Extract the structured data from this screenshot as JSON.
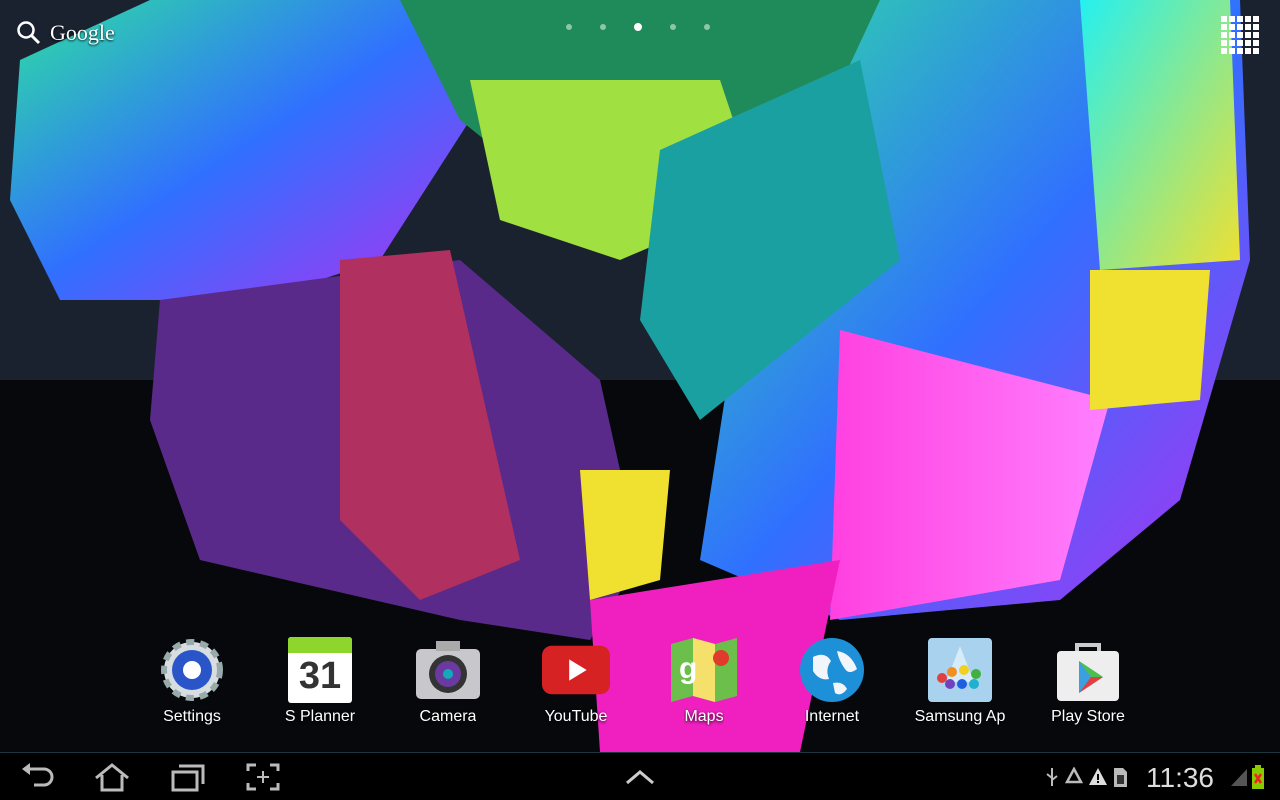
{
  "search": {
    "label": "Google",
    "icon": "search-icon"
  },
  "pages": {
    "count": 5,
    "current": 3
  },
  "dock": [
    {
      "label": "Settings",
      "icon": "gear-icon"
    },
    {
      "label": "S Planner",
      "icon": "calendar-icon",
      "date": "31"
    },
    {
      "label": "Camera",
      "icon": "camera-icon"
    },
    {
      "label": "YouTube",
      "icon": "youtube-icon"
    },
    {
      "label": "Maps",
      "icon": "maps-icon"
    },
    {
      "label": "Internet",
      "icon": "globe-icon"
    },
    {
      "label": "Samsung Ap",
      "icon": "samsung-apps-icon"
    },
    {
      "label": "Play Store",
      "icon": "play-store-icon"
    }
  ],
  "status": {
    "time": "11:36",
    "icons": [
      "usb-icon",
      "recycle-icon",
      "warning-icon",
      "sd-card-icon",
      "signal-icon",
      "battery-icon"
    ]
  },
  "colors": {
    "accent": "#33b5e5",
    "navbar": "#000000"
  }
}
